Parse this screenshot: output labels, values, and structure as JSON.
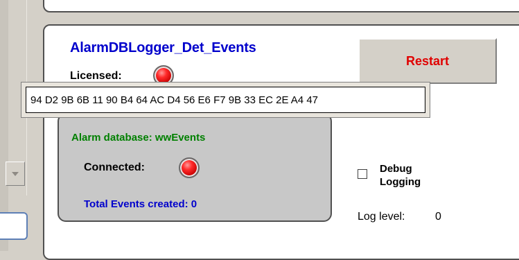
{
  "component": {
    "title": "AlarmDBLogger_Det_Events",
    "licensed_label": "Licensed:",
    "restart_label": "Restart",
    "license_key": "94 D2 9B 6B 11 90 B4 64 AC D4 56 E6 F7 9B 33 EC 2E A4 47"
  },
  "database": {
    "name_label": "Alarm database: wwEvents",
    "connected_label": "Connected:",
    "events_label": "Total Events created: 0"
  },
  "options": {
    "debug_label_line1": "Debug",
    "debug_label_line2": "Logging",
    "debug_checked": false,
    "log_level_label": "Log level:",
    "log_level_value": "0"
  },
  "indicators": {
    "licensed_color": "#ff2a2a",
    "connected_color": "#ff2a2a"
  }
}
